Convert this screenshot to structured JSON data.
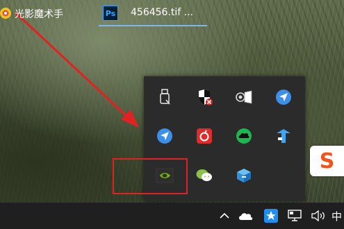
{
  "colors": {
    "highlight": "#e22222",
    "arrow": "#e22222",
    "taskbar": "#1f1f1f",
    "tray_panel": "#2b2b2b",
    "photoshop_blue": "#31a8ff",
    "nvidia_green": "#76b900",
    "sogou_orange": "#f2531d"
  },
  "tray_overflow": {
    "icons": [
      {
        "name": "usb-eject-icon"
      },
      {
        "name": "security-center-icon"
      },
      {
        "name": "audio-device-icon"
      },
      {
        "name": "feishu-arrow-icon"
      },
      {
        "name": "feishu-arrow-icon-2"
      },
      {
        "name": "netease-music-icon"
      },
      {
        "name": "cloud-sync-icon"
      },
      {
        "name": "upload-arrow-icon"
      },
      {
        "name": "nvidia-icon"
      },
      {
        "name": "wechat-icon"
      },
      {
        "name": "stack-box-icon"
      }
    ]
  },
  "sogou_badge": {
    "text": "S"
  },
  "taskbar": {
    "apps": [
      {
        "icon": "light-shadow-icon",
        "label": "光影魔术手"
      },
      {
        "icon": "photoshop-icon",
        "icon_text": "Ps",
        "label": "456456.tif ..."
      }
    ],
    "tray": {
      "chevron": "^",
      "ime_label": "中"
    }
  }
}
